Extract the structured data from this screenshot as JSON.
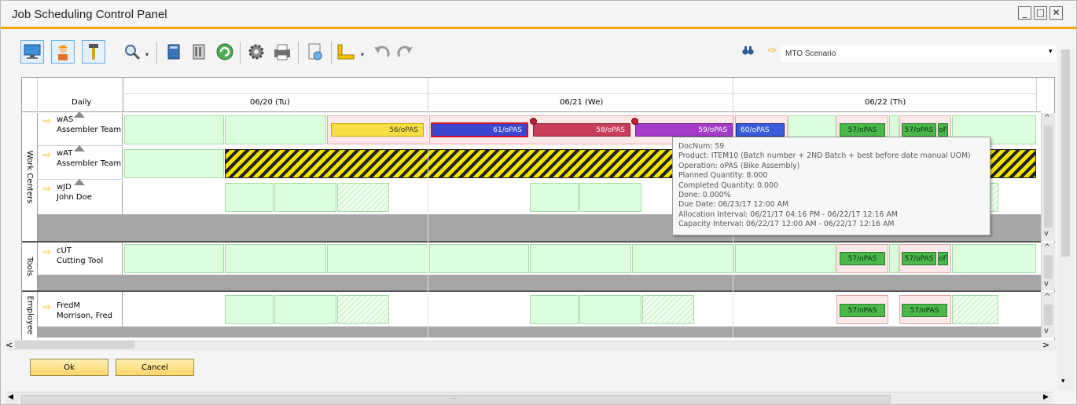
{
  "window": {
    "title": "Job Scheduling Control Panel"
  },
  "window_controls": {
    "minimize": "_",
    "maximize": "□",
    "close": "✕"
  },
  "toolbar": {
    "icons": [
      "monitor-icon",
      "worker-icon",
      "tools-icon",
      "magnifier-icon",
      "database-icon",
      "settings-panel-icon",
      "refresh-icon",
      "gear-icon",
      "printer-icon",
      "export-document-icon",
      "ruler-icon",
      "undo-icon",
      "redo-icon"
    ],
    "find_icon": "binoculars-icon",
    "scenario_arrow": "⇨",
    "scenario_value": "MTO Scenario"
  },
  "grid": {
    "view_label": "Daily",
    "days": [
      "06/20 (Tu)",
      "06/21 (We)",
      "06/22 (Th)"
    ],
    "groups": [
      {
        "label": "Work Centers"
      },
      {
        "label": "Tools"
      },
      {
        "label": "Employee"
      }
    ],
    "resources": [
      {
        "code": "wAS",
        "name": "Assembler Team"
      },
      {
        "code": "wAT",
        "name": "Assembler Team"
      },
      {
        "code": "wJD",
        "name": "John Doe"
      },
      {
        "code": "cUT",
        "name": "Cutting Tool"
      },
      {
        "code": "FredM",
        "name": "Morrison, Fred"
      }
    ],
    "operations": [
      {
        "label": "56/oPAS",
        "color": "#f6df42"
      },
      {
        "label": "61/oPAS",
        "color": "#3a46d0"
      },
      {
        "label": "58/oPAS",
        "color": "#c83c5c"
      },
      {
        "label": "59/oPAS",
        "color": "#a43cc8"
      },
      {
        "label": "60/oPAS",
        "color": "#3a5cd8"
      },
      {
        "label": "57/oPAS",
        "color": "#4cb84c"
      },
      {
        "label": "57/oPAS",
        "color": "#4cb84c"
      },
      {
        "label": "oF",
        "color": "#4cb84c"
      },
      {
        "label": "57/oPAS",
        "color": "#4cb84c"
      },
      {
        "label": "57/oPAS",
        "color": "#4cb84c"
      },
      {
        "label": "oF",
        "color": "#4cb84c"
      },
      {
        "label": "57/oPAS",
        "color": "#4cb84c"
      },
      {
        "label": "57/oPAS",
        "color": "#4cb84c"
      }
    ]
  },
  "tooltip": {
    "lines": [
      "DocNum: 59",
      "Product: ITEM10 (Batch number + 2ND Batch + best before date manual UOM)",
      "Operation: oPAS (Bike Assembly)",
      "Planned Quantity: 8.000",
      "Completed Quantity: 0.000",
      "Done: 0.000%",
      "Due Date: 06/23/17 12:00 AM",
      "Allocation Interval: 06/21/17 04:16 PM - 06/22/17 12:16 AM",
      "Capacity Interval: 06/22/17 12:00 AM - 06/22/17 12:16 AM"
    ]
  },
  "buttons": {
    "ok": "Ok",
    "cancel": "Cancel"
  },
  "scroll": {
    "left": "<",
    "right": ">",
    "up": "^",
    "down": "v",
    "bottom_left": "◀",
    "bottom_right": "▶",
    "grip": ":::"
  }
}
